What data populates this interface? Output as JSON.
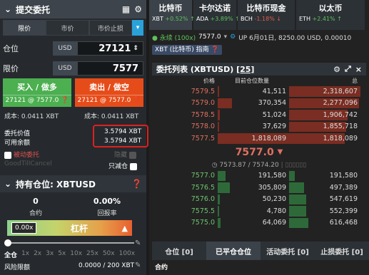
{
  "order_panel": {
    "title": "提交委托",
    "tabs": [
      "限价",
      "市价",
      "市价止损"
    ],
    "qty_label": "仓位",
    "qty_currency": "USD",
    "qty_value": "27121",
    "price_label": "限价",
    "price_currency": "USD",
    "price_value": "7577",
    "buy_label": "买入 / 做多",
    "buy_sub": "27121 @ 7577.0",
    "sell_label": "卖出 / 做空",
    "sell_sub": "27121 @ 7577.0",
    "buy_cost": "成本: 0.0411 XBT",
    "sell_cost": "成本: 0.0411 XBT",
    "order_value_label": "委托价值",
    "order_value": "3.5794 XBT",
    "available_label": "可用余额",
    "available_value": "3.5794 XBT",
    "hidden_label": "被动委托",
    "hidden_extra": "隐藏",
    "gtc_label": "GoodTillCancel",
    "reduce_only_label": "只减仓"
  },
  "position": {
    "title": "持有仓位: XBTUSD",
    "qty_value": "0",
    "qty_label": "合约",
    "roe_value": "0.00%",
    "roe_label": "回报率",
    "leverage_value": "0.00x",
    "leverage_label": "杠杆",
    "leverage_ticks": [
      "全仓",
      "1x",
      "2x",
      "3x",
      "5x",
      "10x",
      "25x",
      "50x",
      "100x"
    ],
    "risk_label": "风险限额",
    "risk_value": "0.0000 / 200 XBT"
  },
  "top_tabs": [
    {
      "name": "比特币",
      "sym": "XBT",
      "chg": "+0.52%",
      "dir": "up"
    },
    {
      "name": "卡尔达诺",
      "sym": "ADA",
      "chg": "+3.89%",
      "dir": "up"
    },
    {
      "name": "比特币现金",
      "sym": "BCH",
      "chg": "-1.18%",
      "dir": "down"
    },
    {
      "name": "以太币",
      "sym": "ETH",
      "chg": "+2.41%",
      "dir": "up"
    }
  ],
  "contract_bar": {
    "perpetual": "永续 (100x)",
    "price": "7577.0",
    "up_text": "UP 6月01日, 8250.00 USD, 0.00010",
    "index_pill": "XBT (比特币) 指南"
  },
  "orderbook": {
    "title": "委托列表 (XBTUSD)",
    "count": "[25]",
    "col_price": "价格",
    "col_size": "目前仓位数量",
    "col_total": "总",
    "asks": [
      {
        "price": "7579.5",
        "size": "41,511",
        "total": "2,318,607"
      },
      {
        "price": "7579.0",
        "size": "370,354",
        "total": "2,277,096"
      },
      {
        "price": "7578.5",
        "size": "51,024",
        "total": "1,906,742"
      },
      {
        "price": "7578.0",
        "size": "37,629",
        "total": "1,855,718"
      },
      {
        "price": "7577.5",
        "size": "1,818,089",
        "total": "1,818,089"
      }
    ],
    "last_price": "7577.0",
    "mark_index": "7573.87 / 7574.20",
    "bids": [
      {
        "price": "7577.0",
        "size": "191,580",
        "total": "191,580"
      },
      {
        "price": "7576.5",
        "size": "305,809",
        "total": "497,389"
      },
      {
        "price": "7576.0",
        "size": "50,230",
        "total": "547,619"
      },
      {
        "price": "7575.5",
        "size": "4,780",
        "total": "552,399"
      },
      {
        "price": "7575.0",
        "size": "64,069",
        "total": "616,468"
      }
    ]
  },
  "bottom_tabs": [
    "仓位 [0]",
    "已平仓仓位",
    "活动委托 [0]",
    "止损委托 [0]"
  ],
  "bottom_row_label": "合约"
}
